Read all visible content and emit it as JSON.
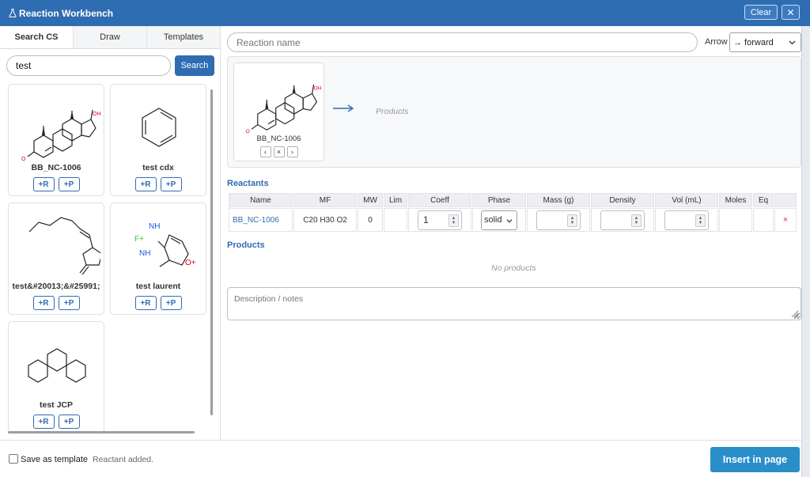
{
  "window": {
    "title": "Reaction Workbench",
    "clear_label": "Clear",
    "close_label": "✕"
  },
  "left": {
    "tabs": [
      "Search CS",
      "Draw",
      "Templates"
    ],
    "search": {
      "value": "test",
      "button_label": "Search"
    },
    "results": [
      {
        "name": "BB_NC-1006",
        "add_reactant": "+R",
        "add_product": "+P",
        "structure": "steroid-molecule"
      },
      {
        "name": "test cdx",
        "add_reactant": "+R",
        "add_product": "+P",
        "structure": "benzene-molecule"
      },
      {
        "name": "test&#20013;&#25991;",
        "add_reactant": "+R",
        "add_product": "+P",
        "structure": "alkene-cyclopentane-molecule"
      },
      {
        "name": "test laurent",
        "add_reactant": "+R",
        "add_product": "+P",
        "structure": "heterocycle-molecule",
        "atom_labels": [
          "NH",
          "F+",
          "NH",
          "O+"
        ]
      },
      {
        "name": "test JCP",
        "add_reactant": "+R",
        "add_product": "+P",
        "structure": "dispiro-molecule"
      }
    ]
  },
  "main": {
    "reaction_name_placeholder": "Reaction name",
    "arrow_label": "Arrow",
    "arrow_value": "→ forward",
    "reaction_scheme": {
      "reactant_card": {
        "name": "BB_NC-1006",
        "nav_prev": "‹",
        "nav_remove": "×",
        "nav_next": "›"
      },
      "products_placeholder": "Products"
    },
    "reactants_heading": "Reactants",
    "columns": [
      "Name",
      "MF",
      "MW",
      "Lim",
      "Coeff",
      "Phase",
      "Mass (g)",
      "Density",
      "Vol (mL)",
      "Moles",
      "Eq",
      ""
    ],
    "reactant_rows": [
      {
        "name": "BB_NC-1006",
        "mf": "C20 H30 O2",
        "mw": "0",
        "lim": "",
        "coeff": "1",
        "phase": "solid",
        "mass": "",
        "density": "",
        "vol": "",
        "moles": "",
        "eq": "",
        "remove": "×"
      }
    ],
    "products_heading": "Products",
    "no_products": "No products",
    "description_placeholder": "Description / notes"
  },
  "footer": {
    "save_template_label": "Save as template",
    "save_template_checked": false,
    "status": "Reactant added.",
    "insert_label": "Insert in page"
  },
  "colors": {
    "primary": "#2f6db2",
    "insert_button": "#2a8ec8",
    "oxygen": "#e0001a",
    "nitrogen": "#1a56d6",
    "fluorine": "#3cc03c"
  }
}
